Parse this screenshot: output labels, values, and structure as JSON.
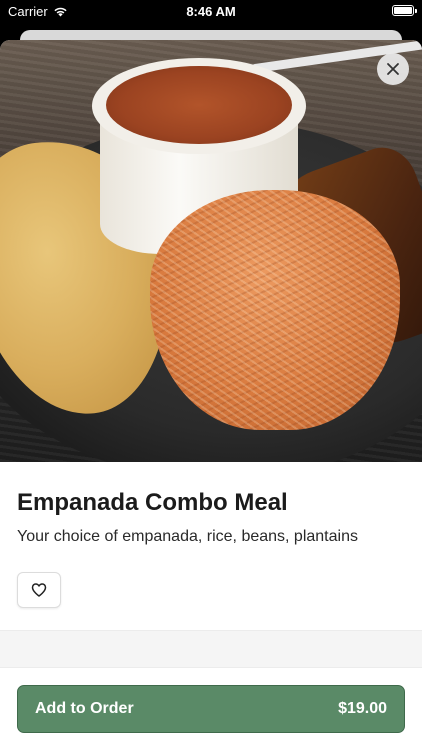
{
  "status_bar": {
    "carrier": "Carrier",
    "time": "8:46 AM",
    "icons": [
      "wifi-icon",
      "battery-icon"
    ]
  },
  "item": {
    "name": "Empanada Combo Meal",
    "description": "Your choice of empanada, rice, beans, plantains",
    "image_alt": "Plate with empanada, rice, bean soup and plantains"
  },
  "actions": {
    "close_icon": "close-icon",
    "favorite_icon": "heart-icon",
    "add_to_order_label": "Add to Order",
    "price": "$19.00"
  },
  "colors": {
    "primary": "#5a8a67",
    "primary_border": "#3f6a4b",
    "text": "#1b1b1b"
  }
}
